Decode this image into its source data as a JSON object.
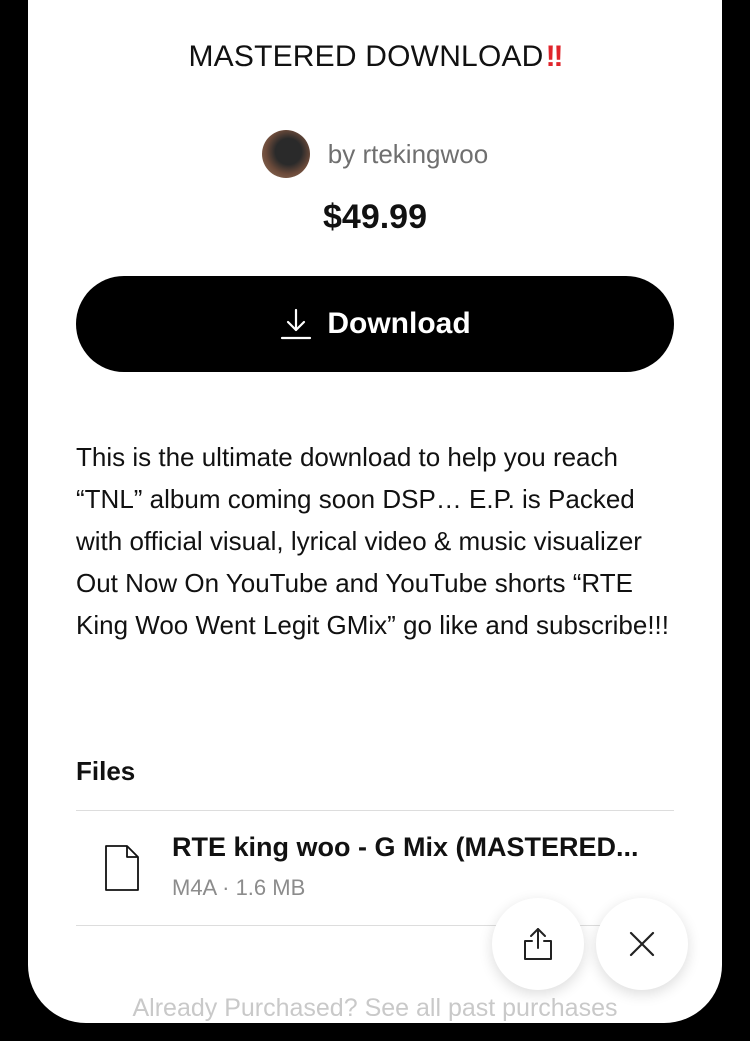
{
  "product": {
    "title": "MASTERED DOWNLOAD",
    "title_emoji": "!!",
    "author": "by rtekingwoo",
    "price": "$49.99"
  },
  "actions": {
    "download_label": "Download"
  },
  "description": "This is the ultimate download to help you reach “TNL” album coming soon DSP… E.P. is Packed with official visual, lyrical video & music visualizer Out Now On YouTube and YouTube shorts “RTE King Woo Went Legit GMix” go like and subscribe!!!",
  "files": {
    "heading": "Files",
    "items": [
      {
        "name": "RTE king woo - G Mix (MASTERED...",
        "meta": "M4A · 1.6 MB"
      }
    ]
  },
  "footer": {
    "purchased_text": "Already Purchased? See all past purchases"
  },
  "icons": {
    "download": "download-icon",
    "file": "file-icon",
    "share": "share-icon",
    "close": "close-icon"
  },
  "colors": {
    "accent": "#000000",
    "emoji_red": "#e0242b",
    "muted_text": "#6f6f6f"
  }
}
